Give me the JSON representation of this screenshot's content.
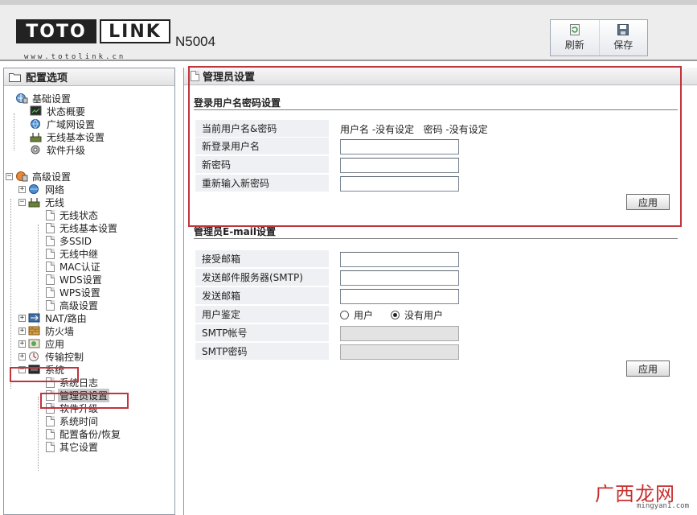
{
  "header": {
    "logo_toto": "TOTO",
    "logo_link": "LINK",
    "model": "N5004",
    "url": "www.totolink.cn",
    "toolbar": {
      "refresh_label": "刷新",
      "save_label": "保存"
    }
  },
  "sidebar": {
    "title": "配置选项",
    "basic": {
      "label": "基础设置",
      "items": [
        "状态概要",
        "广域网设置",
        "无线基本设置",
        "软件升级"
      ]
    },
    "advanced": {
      "label": "高级设置",
      "network": "网络",
      "wireless": {
        "label": "无线",
        "items": [
          "无线状态",
          "无线基本设置",
          "多SSID",
          "无线中继",
          "MAC认证",
          "WDS设置",
          "WPS设置",
          "高级设置"
        ]
      },
      "nat": "NAT/路由",
      "firewall": "防火墙",
      "apps": "应用",
      "traffic": "传输控制",
      "system": {
        "label": "系统",
        "items": [
          "系统日志",
          "管理员设置",
          "软件升级",
          "系统时间",
          "配置备份/恢复",
          "其它设置"
        ]
      }
    }
  },
  "main": {
    "title": "管理员设置",
    "login": {
      "section_title": "登录用户名密码设置",
      "current_label": "当前用户名&密码",
      "current_value": "用户名 -没有设定   密码 -没有设定",
      "new_user_label": "新登录用户名",
      "new_password_label": "新密码",
      "confirm_password_label": "重新输入新密码",
      "new_user_value": "",
      "new_password_value": "",
      "confirm_password_value": "",
      "apply_label": "应用"
    },
    "email": {
      "section_title": "管理员E-mail设置",
      "recv_label": "接受邮箱",
      "smtp_server_label": "发送邮件服务器(SMTP)",
      "sender_label": "发送邮箱",
      "auth_label": "用户鉴定",
      "auth_options": [
        "用户",
        "没有用户"
      ],
      "auth_selected": "没有用户",
      "smtp_account_label": "SMTP帐号",
      "smtp_password_label": "SMTP密码",
      "recv_value": "",
      "smtp_server_value": "",
      "sender_value": "",
      "smtp_account_value": "",
      "smtp_password_value": "",
      "apply_label": "应用"
    }
  },
  "watermark": {
    "main": "广西龙网",
    "sub": "mingyan1.com"
  },
  "colors": {
    "highlight": "#c0343c",
    "label_bg": "#eef0f3",
    "header_bg": "#ededed"
  }
}
